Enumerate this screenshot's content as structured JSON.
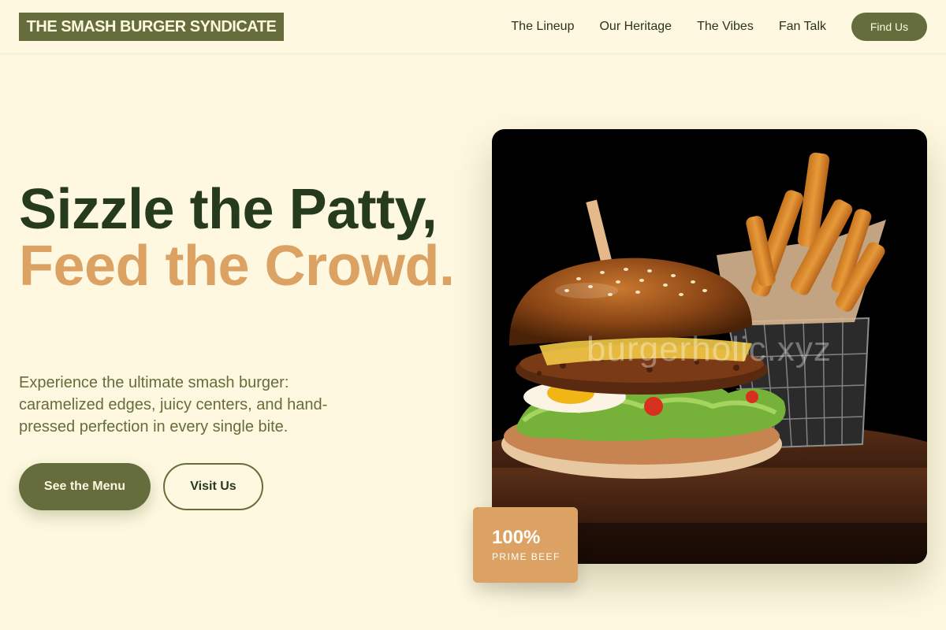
{
  "header": {
    "logo": "THE SMASH BURGER SYNDICATE",
    "nav": [
      {
        "label": "The Lineup"
      },
      {
        "label": "Our Heritage"
      },
      {
        "label": "The Vibes"
      },
      {
        "label": "Fan Talk"
      }
    ],
    "cta": "Find Us"
  },
  "hero": {
    "title_line1": "Sizzle the Patty,",
    "title_line2": "Feed the Crowd.",
    "description": "Experience the ultimate smash burger: caramelized edges, juicy centers, and hand-pressed perfection in every single bite.",
    "primary_button": "See the Menu",
    "secondary_button": "Visit Us",
    "image_watermark": "burgerholic.xyz",
    "badge": {
      "value": "100%",
      "label": "Prime Beef"
    }
  },
  "colors": {
    "background": "#fdf8df",
    "brand_olive": "#646d3b",
    "heading_dark": "#263a1d",
    "accent_orange": "#dba263"
  }
}
